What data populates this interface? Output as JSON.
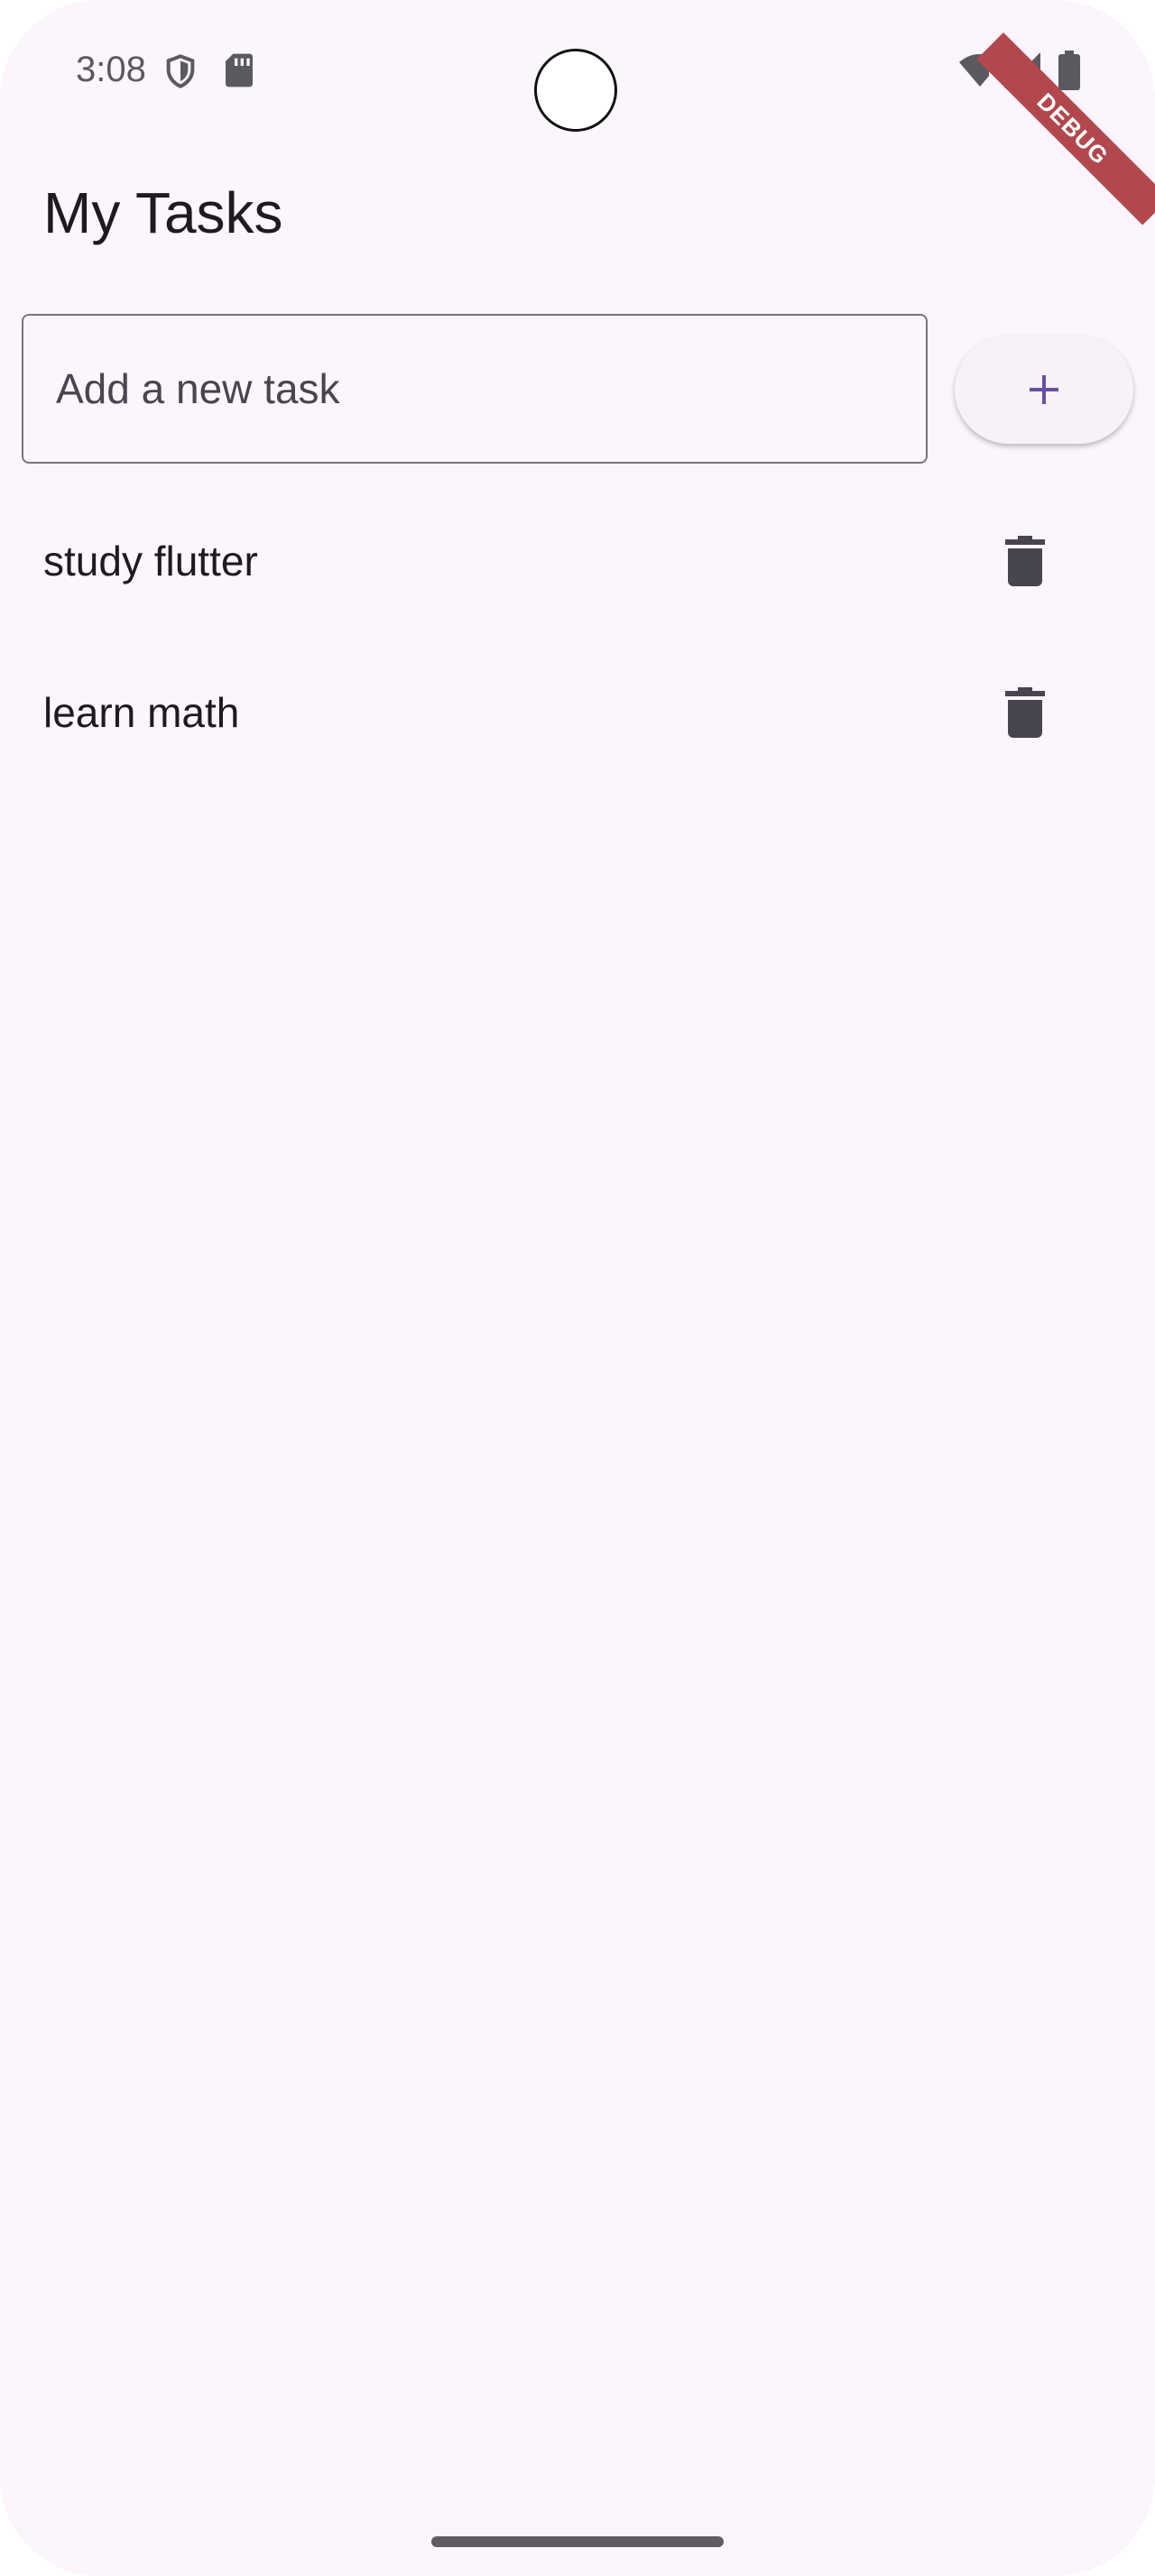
{
  "status_bar": {
    "time": "3:08",
    "icons": [
      "shield-icon",
      "sd-card-icon",
      "wifi-icon",
      "signal-icon",
      "battery-icon"
    ]
  },
  "debug_banner": "DEBUG",
  "app_bar": {
    "title": "My Tasks"
  },
  "new_task": {
    "value": "",
    "placeholder": "Add a new task",
    "add_icon": "plus-icon"
  },
  "tasks": [
    {
      "title": "study flutter",
      "action_icon": "trash-icon"
    },
    {
      "title": "learn math",
      "action_icon": "trash-icon"
    }
  ],
  "colors": {
    "background": "#fcf5fd",
    "accent": "#6750a4",
    "text": "#1d1b20",
    "debug_banner": "#b2484d"
  }
}
